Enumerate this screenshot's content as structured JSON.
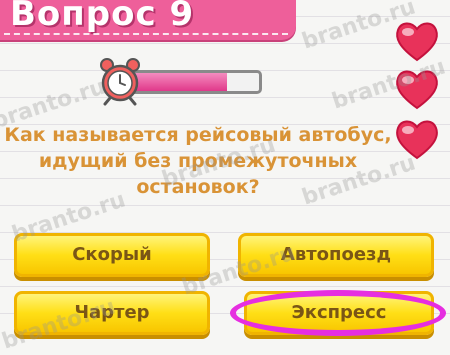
{
  "header": {
    "title": "Вопрос 9"
  },
  "lives": {
    "count": 3,
    "icon": "heart-icon",
    "color": "#e8325a"
  },
  "timer": {
    "icon": "alarm-clock-icon",
    "fraction_remaining": 0.76,
    "bar_color": "#e0388a"
  },
  "question": {
    "lines": [
      "Как называется рейсовый автобус,",
      "идущий без промежуточных",
      "остановок?"
    ]
  },
  "answers": [
    {
      "label": "Скорый"
    },
    {
      "label": "Автопоезд"
    },
    {
      "label": "Чартер"
    },
    {
      "label": "Экспресс",
      "highlighted": true
    }
  ],
  "highlight_color": "#e62ee0",
  "watermark": "branto.ru"
}
